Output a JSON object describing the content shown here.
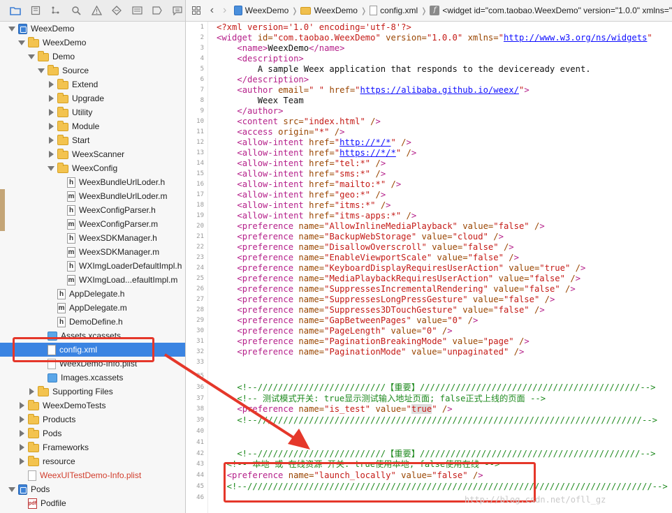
{
  "navigator_toolbar": {
    "icons": [
      "folder-icon",
      "source-control-icon",
      "hierarchy-icon",
      "search-icon",
      "warning-icon",
      "test-icon",
      "debug-icon",
      "breakpoint-icon",
      "report-icon"
    ]
  },
  "jump_bar": {
    "crumbs": [
      "WeexDemo",
      "WeexDemo",
      "config.xml",
      "<widget id=\"com.taobao.WeexDemo\" version=\"1.0.0\" xmlns=\""
    ]
  },
  "tree": [
    {
      "label": "WeexDemo",
      "icon": "project-icon",
      "indent": 0,
      "disclosure": "down"
    },
    {
      "label": "WeexDemo",
      "icon": "folder-icon",
      "indent": 1,
      "disclosure": "down"
    },
    {
      "label": "Demo",
      "icon": "folder-icon",
      "indent": 2,
      "disclosure": "down"
    },
    {
      "label": "Source",
      "icon": "folder-icon",
      "indent": 3,
      "disclosure": "down"
    },
    {
      "label": "Extend",
      "icon": "folder-icon",
      "indent": 4,
      "disclosure": "right"
    },
    {
      "label": "Upgrade",
      "icon": "folder-icon",
      "indent": 4,
      "disclosure": "right"
    },
    {
      "label": "Utility",
      "icon": "folder-icon",
      "indent": 4,
      "disclosure": "right"
    },
    {
      "label": "Module",
      "icon": "folder-icon",
      "indent": 4,
      "disclosure": "right"
    },
    {
      "label": "Start",
      "icon": "folder-icon",
      "indent": 4,
      "disclosure": "right"
    },
    {
      "label": "WeexScanner",
      "icon": "folder-icon",
      "indent": 4,
      "disclosure": "right"
    },
    {
      "label": "WeexConfig",
      "icon": "folder-icon",
      "indent": 4,
      "disclosure": "down"
    },
    {
      "label": "WeexBundleUrlLoder.h",
      "icon": "header-file-icon",
      "indent": 5,
      "disclosure": "none"
    },
    {
      "label": "WeexBundleUrlLoder.m",
      "icon": "m-file-icon",
      "indent": 5,
      "disclosure": "none"
    },
    {
      "label": "WeexConfigParser.h",
      "icon": "header-file-icon",
      "indent": 5,
      "disclosure": "none"
    },
    {
      "label": "WeexConfigParser.m",
      "icon": "m-file-icon",
      "indent": 5,
      "disclosure": "none"
    },
    {
      "label": "WeexSDKManager.h",
      "icon": "header-file-icon",
      "indent": 5,
      "disclosure": "none"
    },
    {
      "label": "WeexSDKManager.m",
      "icon": "m-file-icon",
      "indent": 5,
      "disclosure": "none"
    },
    {
      "label": "WXImgLoaderDefaultImpl.h",
      "icon": "header-file-icon",
      "indent": 5,
      "disclosure": "none"
    },
    {
      "label": "WXImgLoad...efaultImpl.m",
      "icon": "m-file-icon",
      "indent": 5,
      "disclosure": "none"
    },
    {
      "label": "AppDelegate.h",
      "icon": "header-file-icon",
      "indent": 4,
      "disclosure": "none"
    },
    {
      "label": "AppDelegate.m",
      "icon": "m-file-icon",
      "indent": 4,
      "disclosure": "none"
    },
    {
      "label": "DemoDefine.h",
      "icon": "header-file-icon",
      "indent": 4,
      "disclosure": "none"
    },
    {
      "label": "Assets.xcassets",
      "icon": "assets-icon",
      "indent": 3,
      "disclosure": "none"
    },
    {
      "label": "config.xml",
      "icon": "xml-file-icon",
      "indent": 3,
      "disclosure": "none",
      "selected": true
    },
    {
      "label": "WeexDemo-Info.plist",
      "icon": "plist-file-icon",
      "indent": 3,
      "disclosure": "none"
    },
    {
      "label": "Images.xcassets",
      "icon": "assets-icon",
      "indent": 3,
      "disclosure": "none"
    },
    {
      "label": "Supporting Files",
      "icon": "folder-icon",
      "indent": 2,
      "disclosure": "right"
    },
    {
      "label": "WeexDemoTests",
      "icon": "folder-icon",
      "indent": 1,
      "disclosure": "right"
    },
    {
      "label": "Products",
      "icon": "folder-icon",
      "indent": 1,
      "disclosure": "right"
    },
    {
      "label": "Pods",
      "icon": "folder-icon",
      "indent": 1,
      "disclosure": "right"
    },
    {
      "label": "Frameworks",
      "icon": "folder-icon",
      "indent": 1,
      "disclosure": "right"
    },
    {
      "label": "resource",
      "icon": "folder-icon",
      "indent": 1,
      "disclosure": "right"
    },
    {
      "label": "WeexUITestDemo-Info.plist",
      "icon": "plist-file-icon",
      "indent": 1,
      "disclosure": "none",
      "red": true
    },
    {
      "label": "Pods",
      "icon": "project-icon",
      "indent": 0,
      "disclosure": "down"
    },
    {
      "label": "Podfile",
      "icon": "pdf-file-icon",
      "indent": 1,
      "disclosure": "none"
    }
  ],
  "code": {
    "line_numbers": [
      "1",
      "2",
      "3",
      "4",
      "5",
      "6",
      "7",
      "8",
      "9",
      "10",
      "11",
      "12",
      "13",
      "14",
      "15",
      "16",
      "17",
      "18",
      "19",
      "20",
      "21",
      "22",
      "23",
      "24",
      "25",
      "26",
      "27",
      "28",
      "29",
      "30",
      "31",
      "32",
      "33",
      "35",
      "36",
      "37",
      "38",
      "39",
      "40",
      "41",
      "42",
      "43",
      "44",
      "45",
      "46"
    ],
    "lines": [
      "<?xml version='1.0' encoding='utf-8'?>",
      "<widget id=\"com.taobao.WeexDemo\" version=\"1.0.0\" xmlns=\"http://www.w3.org/ns/widgets\"",
      "    <name>WeexDemo</name>",
      "    <description>",
      "        A sample Weex application that responds to the deviceready event.",
      "    </description>",
      "    <author email=\" \" href=\"https://alibaba.github.io/weex/\">",
      "        Weex Team",
      "    </author>",
      "    <content src=\"index.html\" />",
      "    <access origin=\"*\" />",
      "    <allow-intent href=\"http://*/*\" />",
      "    <allow-intent href=\"https://*/*\" />",
      "    <allow-intent href=\"tel:*\" />",
      "    <allow-intent href=\"sms:*\" />",
      "    <allow-intent href=\"mailto:*\" />",
      "    <allow-intent href=\"geo:*\" />",
      "    <allow-intent href=\"itms:*\" />",
      "    <allow-intent href=\"itms-apps:*\" />",
      "    <preference name=\"AllowInlineMediaPlayback\" value=\"false\" />",
      "    <preference name=\"BackupWebStorage\" value=\"cloud\" />",
      "    <preference name=\"DisallowOverscroll\" value=\"false\" />",
      "    <preference name=\"EnableViewportScale\" value=\"false\" />",
      "    <preference name=\"KeyboardDisplayRequiresUserAction\" value=\"true\" />",
      "    <preference name=\"MediaPlaybackRequiresUserAction\" value=\"false\" />",
      "    <preference name=\"SuppressesIncrementalRendering\" value=\"false\" />",
      "    <preference name=\"SuppressesLongPressGesture\" value=\"false\" />",
      "    <preference name=\"Suppresses3DTouchGesture\" value=\"false\" />",
      "    <preference name=\"GapBetweenPages\" value=\"0\" />",
      "    <preference name=\"PageLength\" value=\"0\" />",
      "    <preference name=\"PaginationBreakingMode\" value=\"page\" />",
      "    <preference name=\"PaginationMode\" value=\"unpaginated\" />",
      "",
      "",
      "    <!--/////////////////////////【重要】///////////////////////////////////////////-->",
      "    <!-- 测试模式开关: true显示测试输入地址页面; false正式上线的页面 -->",
      "    <preference name=\"is_test\" value=\"true\" />",
      "    <!--///////////////////////////////////////////////////////////////////////////-->",
      "",
      "",
      "    <!--/////////////////////////【重要】///////////////////////////////////////////-->",
      "  <!-- 本地 或 在线资源 开关: true使用本地, false使用在线 -->",
      "  <preference name=\"launch_locally\" value=\"false\" />",
      "  <!--///////////////////////////////////////////////////////////////////////////////-->",
      ""
    ]
  },
  "watermark": "http://blog.csdn.net/ofll_gz",
  "colors": {
    "tag": "#b5208a",
    "attr": "#994500",
    "value": "#c41a16",
    "comment": "#1f8a1f",
    "url": "#0e0eff",
    "selection": "#3b84e2",
    "annotation": "#e5372a"
  }
}
